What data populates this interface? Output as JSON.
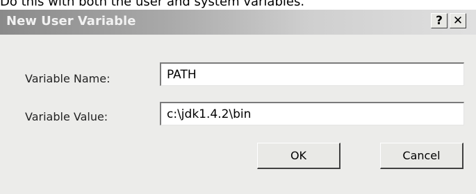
{
  "page": {
    "intro_text": "Do this with both the user and system variables."
  },
  "dialog": {
    "title": "New User Variable",
    "help_label": "?",
    "close_label": "✕",
    "variable_name_label": "Variable Name:",
    "variable_name_value": "PATH",
    "variable_value_label": "Variable Value:",
    "variable_value_value": "c:\\jdk1.4.2\\bin",
    "ok_label": "OK",
    "cancel_label": "Cancel"
  },
  "colors": {
    "dialog_background": "#ececea",
    "titlebar_start": "#8a8a8a",
    "titlebar_end": "#e0e0e0"
  }
}
